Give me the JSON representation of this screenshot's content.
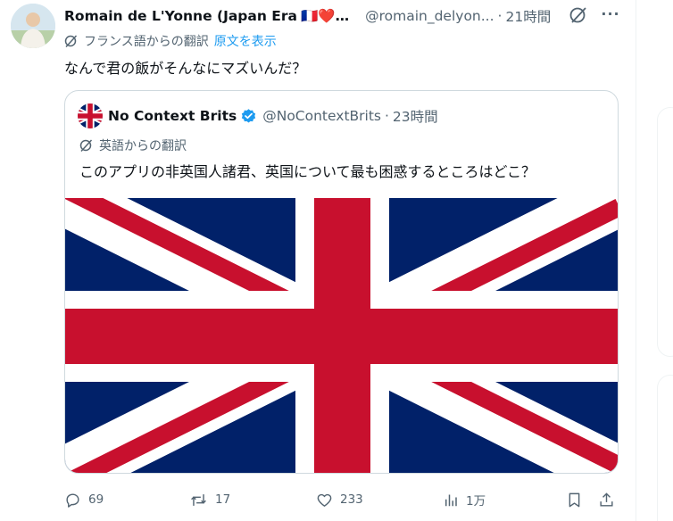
{
  "tweet": {
    "author_name": "Romain de L'Yonne (Japan Era",
    "author_flags": "🇫🇷❤️…",
    "handle": "@romain_delyon...",
    "time": "21時間",
    "translation_label": "フランス語からの翻訳",
    "show_original": "原文を表示",
    "text": "なんで君の飯がそんなにマズいんだ？"
  },
  "quote": {
    "author_name": "No Context Brits",
    "handle": "@NoContextBrits",
    "time": "23時間",
    "translation_label": "英語からの翻訳",
    "text": "このアプリの非英国人諸君、英国について最も困惑するところはどこ？",
    "image_alt": "Union Jack flag"
  },
  "actions": {
    "replies": "69",
    "reposts": "17",
    "likes": "233",
    "views": "1万"
  },
  "icons": {
    "grok": "grok-icon",
    "more": "more-icon",
    "translate": "translate-icon",
    "verified": "verified-badge-icon",
    "reply": "reply-icon",
    "repost": "repost-icon",
    "like": "like-icon",
    "views": "views-icon",
    "bookmark": "bookmark-icon",
    "share": "share-icon"
  },
  "colors": {
    "link": "#1d9bf0",
    "muted": "#536471",
    "flag_blue": "#012169",
    "flag_red": "#C8102E"
  }
}
